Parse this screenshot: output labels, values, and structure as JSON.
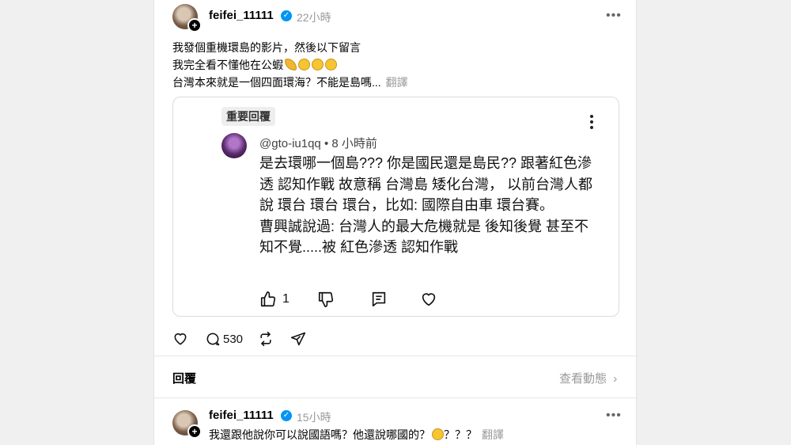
{
  "post": {
    "username": "feifei_11111",
    "time": "22小時",
    "text_line1": "我發個重機環島的影片，然後以下留言",
    "text_line2": "我完全看不懂他在公蝦",
    "text_line3": "台灣本來就是一個四面環海？不能是島嗎...",
    "translate": "翻譯",
    "quoted_reply": {
      "badge": "重要回覆",
      "username": "@gto-iu1qq",
      "time": "8 小時前",
      "paragraph1": "是去環哪一個島??? 你是國民還是島民?? 跟著紅色滲透 認知作戰 故意稱 台灣島 矮化台灣，   以前台灣人都說  環台  環台  環台，比如: 國際自由車 環台賽。",
      "paragraph2": "曹興誠說過: 台灣人的最大危機就是 後知後覺 甚至不知不覺.....被 紅色滲透  認知作戰",
      "like_count": "1"
    },
    "comment_count": "530"
  },
  "replies_section": {
    "label": "回覆",
    "view_activity": "查看動態"
  },
  "reply": {
    "username": "feifei_11111",
    "time": "15小時",
    "text": "我還跟他說你可以說國語嗎？他還說哪國的？",
    "text_tail": "？？？",
    "translate": "翻譯"
  },
  "colors": {
    "verified": "#0095f6",
    "muted_text": "#999999",
    "background": "#f0f0f0"
  }
}
